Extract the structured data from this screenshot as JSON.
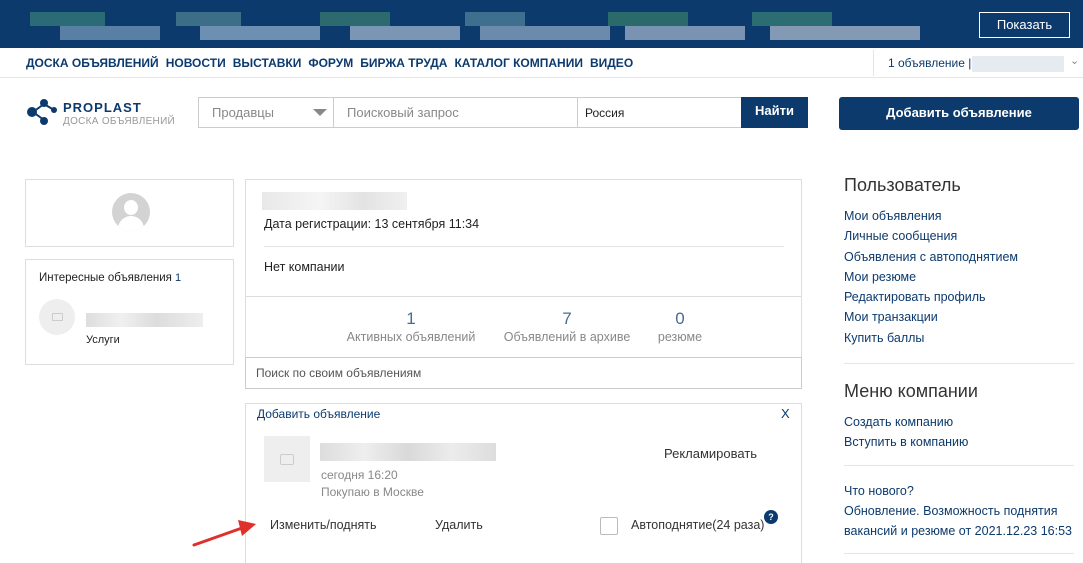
{
  "banner": {
    "show_label": "Показать"
  },
  "nav": {
    "links": [
      "ДОСКА ОБЪЯВЛЕНИЙ",
      "НОВОСТИ",
      "ВЫСТАВКИ",
      "ФОРУМ",
      "БИРЖА ТРУДА",
      "КАТАЛОГ КОМПАНИИ",
      "ВИДЕО"
    ],
    "user_info": "1 объявление |"
  },
  "logo": {
    "title": "PROPLAST",
    "subtitle": "ДОСКА ОБЪЯВЛЕНИЙ"
  },
  "search": {
    "category": "Продавцы",
    "query_placeholder": "Поисковый запрос",
    "region": "Россия",
    "submit_label": "Найти"
  },
  "add_ad_label": "Добавить объявление",
  "interesting": {
    "title": "Интересные объявления",
    "count": "1",
    "item_category": "Услуги"
  },
  "profile": {
    "registration": "Дата регистрации: 13 сентября 11:34",
    "company": "Нет компании"
  },
  "stats": [
    {
      "value": "1",
      "label": "Активных объявлений"
    },
    {
      "value": "7",
      "label": "Объявлений в архиве"
    },
    {
      "value": "0",
      "label": "резюме"
    }
  ],
  "own_search_placeholder": "Поиск по своим объявлениям",
  "ad": {
    "add_label": "Добавить объявление",
    "close": "X",
    "promote": "Рекламировать",
    "date": "сегодня 16:20",
    "location": "Покупаю в Москве",
    "edit": "Изменить/поднять",
    "delete": "Удалить",
    "autoraise": "Автоподнятие(24 раза)",
    "help": "?"
  },
  "sidebar": {
    "user_title": "Пользователь",
    "user_links": [
      "Мои объявления",
      "Личные сообщения",
      "Объявления с автоподнятием",
      "Мои резюме",
      "Редактировать профиль",
      "Мои транзакции",
      "Купить баллы"
    ],
    "company_title": "Меню компании",
    "company_links": [
      "Создать компанию",
      "Вступить в компанию"
    ],
    "news_title": "Что нового?",
    "news_text": "Обновление. Возможность поднятия вакансий и резюме от 2021.12.23 16:53"
  },
  "colors": {
    "brand": "#0c3a6d",
    "arrow": "#e0302b"
  }
}
